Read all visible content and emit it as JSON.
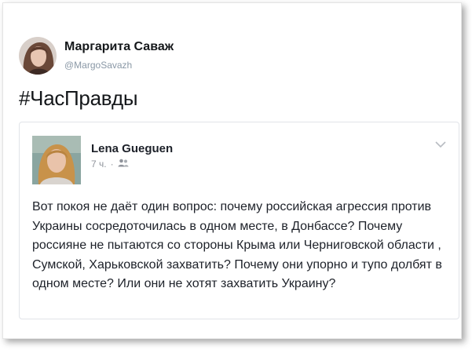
{
  "tweet": {
    "author_name": "Маргарита Саваж",
    "author_handle": "@MargoSavazh",
    "text": "#ЧасПравды"
  },
  "quoted_post": {
    "author_name": "Lena Gueguen",
    "time": "7 ч.",
    "separator": "·",
    "privacy_icon": "friends-icon",
    "body": "Вот покоя не даёт один вопрос: почему российская агрессия против Украины сосредоточилась в одном месте, в Донбассе? Почему россияне не пытаются со стороны Крыма или Черниговской области , Сумской, Харьковской захватить? Почему они упорно и тупо долбят в одном месте? Или они не хотят захватить Украину?"
  },
  "colors": {
    "text_primary": "#14171a",
    "handle_gray": "#8a98a6",
    "quote_border": "#e1e4e8"
  }
}
